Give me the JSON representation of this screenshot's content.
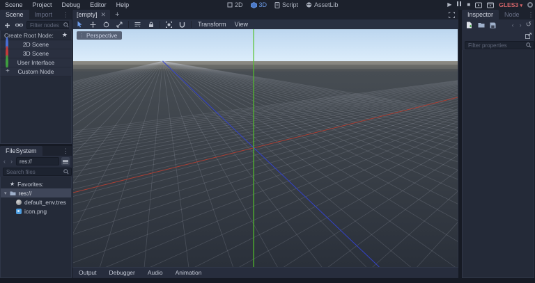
{
  "menu_bar": {
    "items": [
      "Scene",
      "Project",
      "Debug",
      "Editor",
      "Help"
    ]
  },
  "workspaces": {
    "d2": "2D",
    "d3": "3D",
    "script": "Script",
    "assetlib": "AssetLib"
  },
  "run_bar": {
    "renderer": "GLES3"
  },
  "scene_dock": {
    "tab_scene": "Scene",
    "tab_import": "Import",
    "filter_placeholder": "Filter nodes",
    "create_root_label": "Create Root Node:",
    "options": [
      {
        "label": "2D Scene",
        "color": "#4a6fd4"
      },
      {
        "label": "3D Scene",
        "color": "#c33b3b"
      },
      {
        "label": "User Interface",
        "color": "#3f9e3f"
      },
      {
        "label": "Custom Node",
        "color": "#a6acb9"
      }
    ]
  },
  "filesystem_dock": {
    "title": "FileSystem",
    "path": "res://",
    "search_placeholder": "Search files",
    "favorites_label": "Favorites:",
    "root_folder": "res://",
    "files": [
      {
        "name": "default_env.tres"
      },
      {
        "name": "icon.png"
      }
    ]
  },
  "viewport": {
    "tab_label": "[empty]",
    "perspective_label": "Perspective",
    "transform_menu": "Transform",
    "view_menu": "View",
    "colors": {
      "sky_top": "#bcd6ef",
      "sky_bottom": "#dcedfb",
      "horizon": "#6e6b62",
      "ground_top": "#474d53",
      "ground_bottom": "#2a303a",
      "grid": "rgba(176,184,194,0.22)",
      "axis_x": "#ad3f34",
      "axis_y": "#53c22b",
      "axis_z": "#3342cb"
    }
  },
  "bottom_bar": {
    "items": [
      "Output",
      "Debugger",
      "Audio",
      "Animation"
    ]
  },
  "inspector_dock": {
    "tab_inspector": "Inspector",
    "tab_node": "Node",
    "filter_placeholder": "Filter properties"
  }
}
